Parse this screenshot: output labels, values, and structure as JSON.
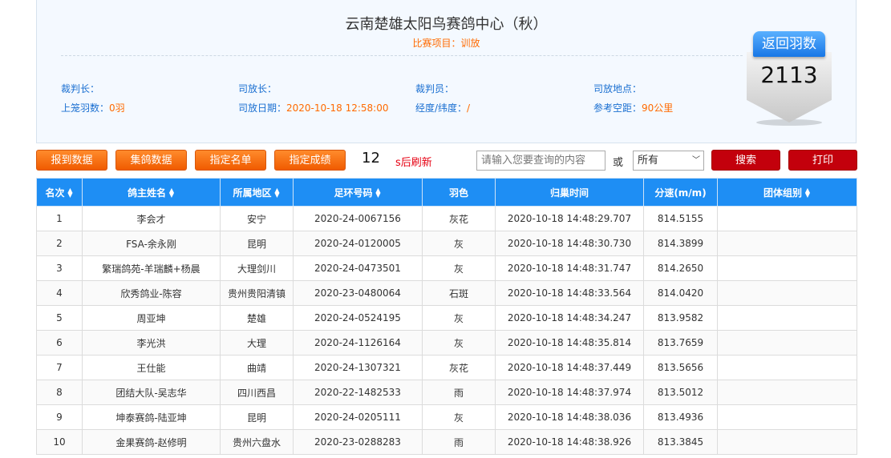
{
  "header": {
    "title": "云南楚雄太阳鸟赛鸽中心（秋）",
    "subtitle": "比赛项目：训放",
    "info": [
      {
        "label": "裁判长：",
        "value": ""
      },
      {
        "label": "司放长：",
        "value": ""
      },
      {
        "label": "裁判员：",
        "value": ""
      },
      {
        "label": "司放地点：",
        "value": ""
      },
      {
        "label": "上笼羽数：",
        "value": "0羽"
      },
      {
        "label": "司放日期：",
        "value": "2020-10-18 12:58:00"
      },
      {
        "label": "经度/纬度：",
        "value": "/"
      },
      {
        "label": "参考空距：",
        "value": "90公里"
      }
    ]
  },
  "badge": {
    "label": "返回羽数",
    "count": "2113"
  },
  "toolbar": {
    "buttons": [
      "报到数据",
      "集鸽数据",
      "指定名单",
      "指定成绩"
    ],
    "countdown": "12",
    "refresh_text": "s后刷新",
    "search_placeholder": "请输入您要查询的内容",
    "or_text": "或",
    "select_value": "所有",
    "search_label": "搜索",
    "print_label": "打印"
  },
  "table": {
    "columns": [
      "名次",
      "鸽主姓名",
      "所属地区",
      "足环号码",
      "羽色",
      "归巢时间",
      "分速(m/m)",
      "团体组别"
    ],
    "rows": [
      [
        "1",
        "李会才",
        "安宁",
        "2020-24-0067156",
        "灰花",
        "2020-10-18 14:48:29.707",
        "814.5155",
        ""
      ],
      [
        "2",
        "FSA-余永刚",
        "昆明",
        "2020-24-0120005",
        "灰",
        "2020-10-18 14:48:30.730",
        "814.3899",
        ""
      ],
      [
        "3",
        "繁瑞鸽苑-羊瑞麟+杨晨",
        "大理剑川",
        "2020-24-0473501",
        "灰",
        "2020-10-18 14:48:31.747",
        "814.2650",
        ""
      ],
      [
        "4",
        "欣秀鸽业-陈容",
        "贵州贵阳清镇",
        "2020-23-0480064",
        "石斑",
        "2020-10-18 14:48:33.564",
        "814.0420",
        ""
      ],
      [
        "5",
        "周亚坤",
        "楚雄",
        "2020-24-0524195",
        "灰",
        "2020-10-18 14:48:34.247",
        "813.9582",
        ""
      ],
      [
        "6",
        "李光洪",
        "大理",
        "2020-24-1126164",
        "灰",
        "2020-10-18 14:48:35.814",
        "813.7659",
        ""
      ],
      [
        "7",
        "王仕能",
        "曲靖",
        "2020-24-1307321",
        "灰花",
        "2020-10-18 14:48:37.449",
        "813.5656",
        ""
      ],
      [
        "8",
        "团结大队-吴志华",
        "四川西昌",
        "2020-22-1482533",
        "雨",
        "2020-10-18 14:48:37.974",
        "813.5012",
        ""
      ],
      [
        "9",
        "坤泰赛鸽-陆亚坤",
        "昆明",
        "2020-24-0205111",
        "灰",
        "2020-10-18 14:48:38.036",
        "813.4936",
        ""
      ],
      [
        "10",
        "金果赛鸽-赵修明",
        "贵州六盘水",
        "2020-23-0288283",
        "雨",
        "2020-10-18 14:48:38.926",
        "813.3845",
        ""
      ]
    ]
  },
  "colors": {
    "accent": "#1e8ef4",
    "orange": "#ff6a00",
    "red": "#c3000c"
  }
}
